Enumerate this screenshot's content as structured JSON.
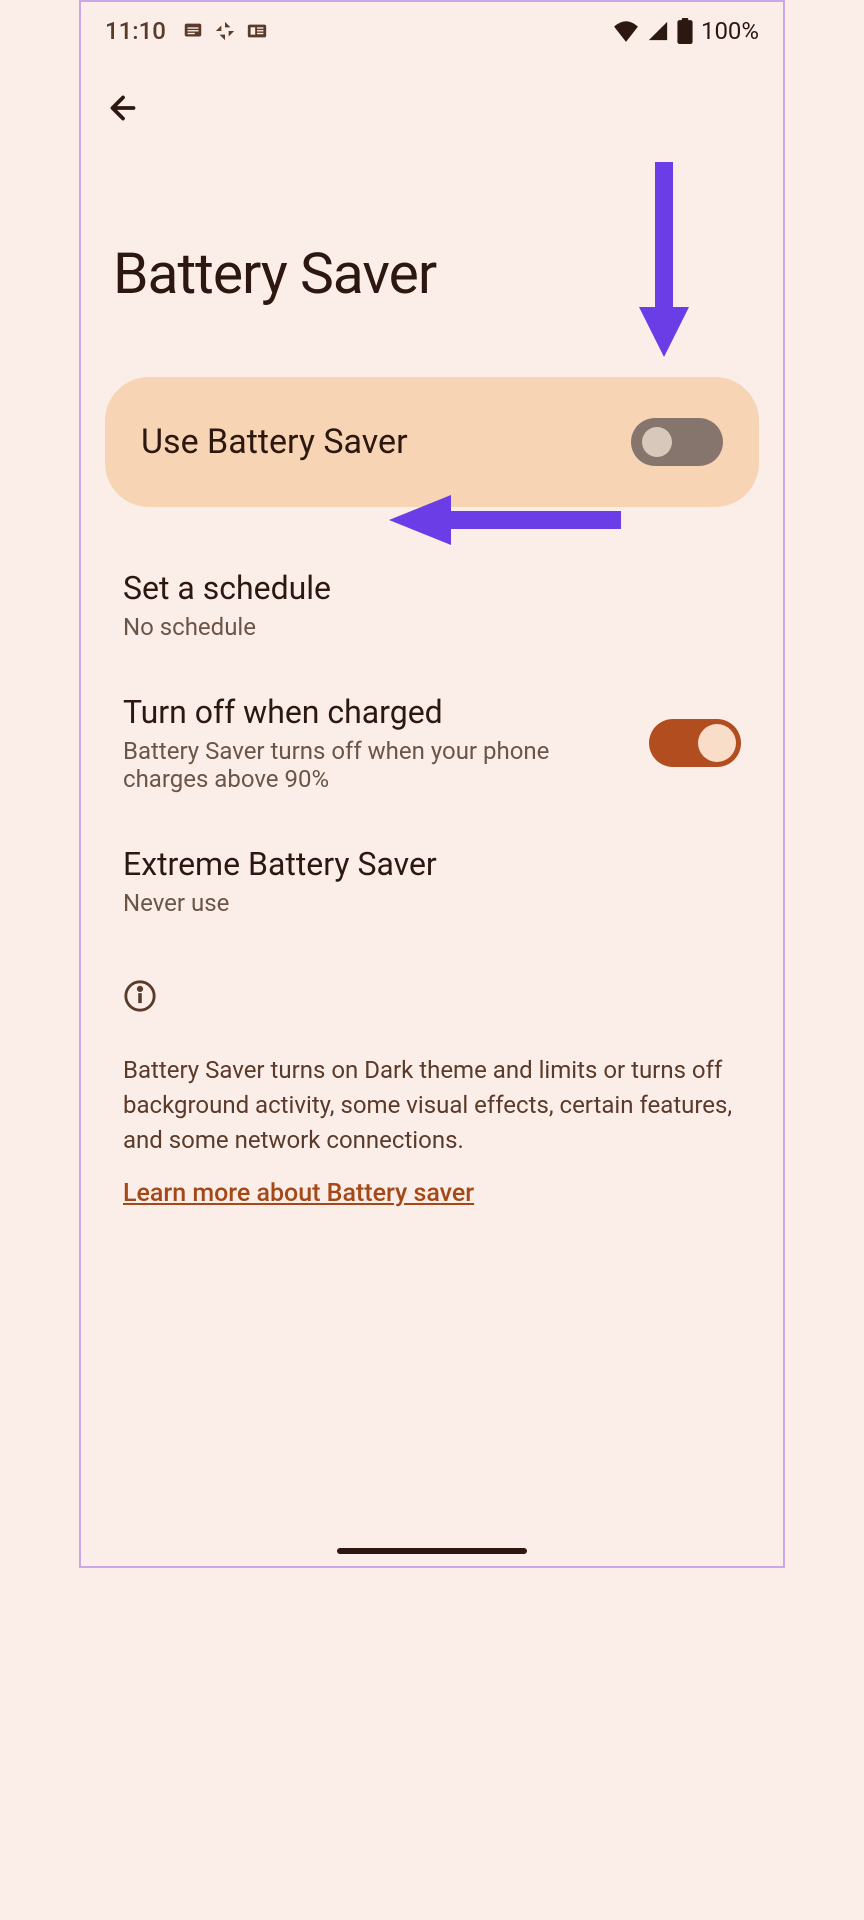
{
  "status": {
    "time": "11:10",
    "battery_pct": "100%"
  },
  "header": {
    "title": "Battery Saver"
  },
  "main_toggle": {
    "label": "Use Battery Saver",
    "enabled": false
  },
  "rows": {
    "schedule": {
      "title": "Set a schedule",
      "subtitle": "No schedule"
    },
    "turn_off": {
      "title": "Turn off when charged",
      "subtitle": "Battery Saver turns off when your phone charges above 90%",
      "enabled": true
    },
    "extreme": {
      "title": "Extreme Battery Saver",
      "subtitle": "Never use"
    }
  },
  "info": {
    "text": "Battery Saver turns on Dark theme and limits or turns off background activity, some visual effects, certain features, and some network connections.",
    "learn_more": "Learn more about Battery saver"
  },
  "colors": {
    "accent": "#b14d1f",
    "annotation": "#6b3de6"
  }
}
